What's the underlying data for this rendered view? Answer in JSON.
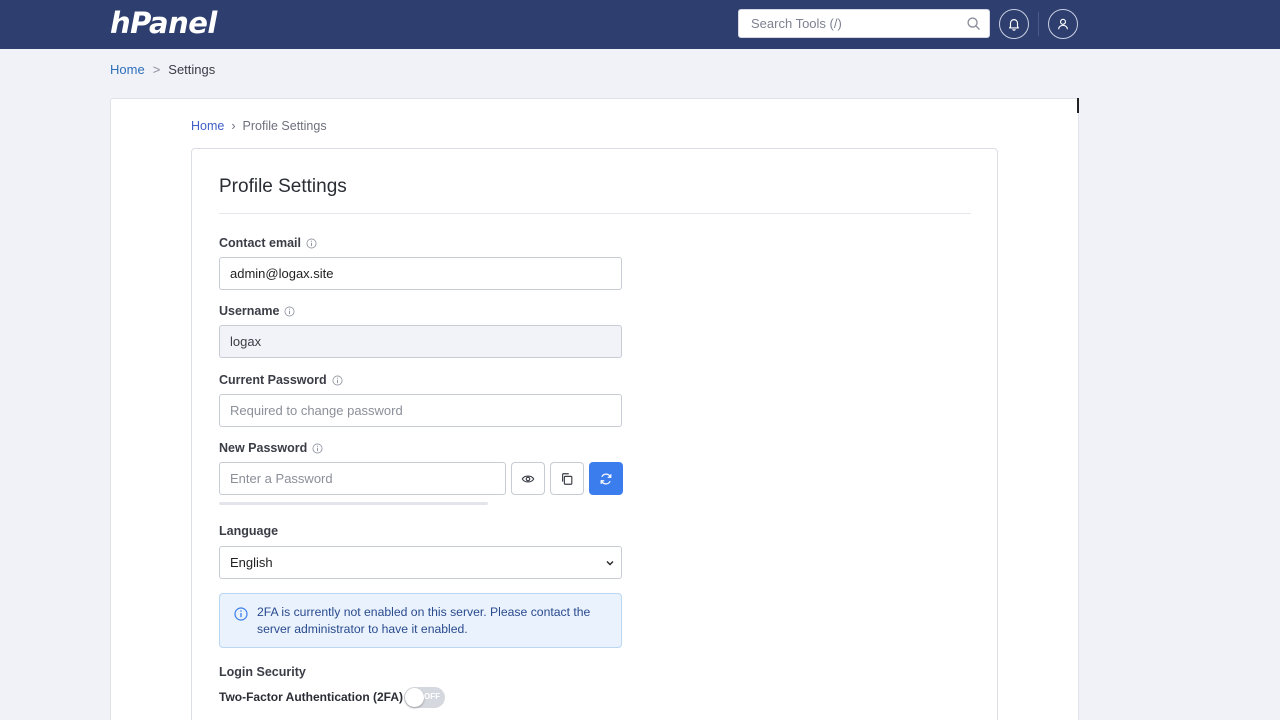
{
  "header": {
    "logo": "hPanel",
    "search_placeholder": "Search Tools (/)"
  },
  "breadcrumb_top": {
    "home": "Home",
    "sep": ">",
    "current": "Settings"
  },
  "breadcrumb_inner": {
    "home": "Home",
    "sep": "›",
    "current": "Profile Settings"
  },
  "page": {
    "title": "Profile Settings"
  },
  "form": {
    "contact_email": {
      "label": "Contact email",
      "value": "admin@logax.site"
    },
    "username": {
      "label": "Username",
      "value": "logax"
    },
    "current_password": {
      "label": "Current Password",
      "placeholder": "Required to change password"
    },
    "new_password": {
      "label": "New Password",
      "placeholder": "Enter a Password",
      "strength": 0
    },
    "language": {
      "label": "Language",
      "value": "English"
    }
  },
  "alert": {
    "text": "2FA is currently not enabled on this server. Please contact the server administrator to have it enabled."
  },
  "login_security": {
    "title": "Login Security",
    "tfa_label": "Two-Factor Authentication (2FA)",
    "tfa_state": "OFF"
  },
  "colors": {
    "topbar": "#2d3e6f",
    "primary": "#3b7ded",
    "link": "#2f6fba"
  }
}
